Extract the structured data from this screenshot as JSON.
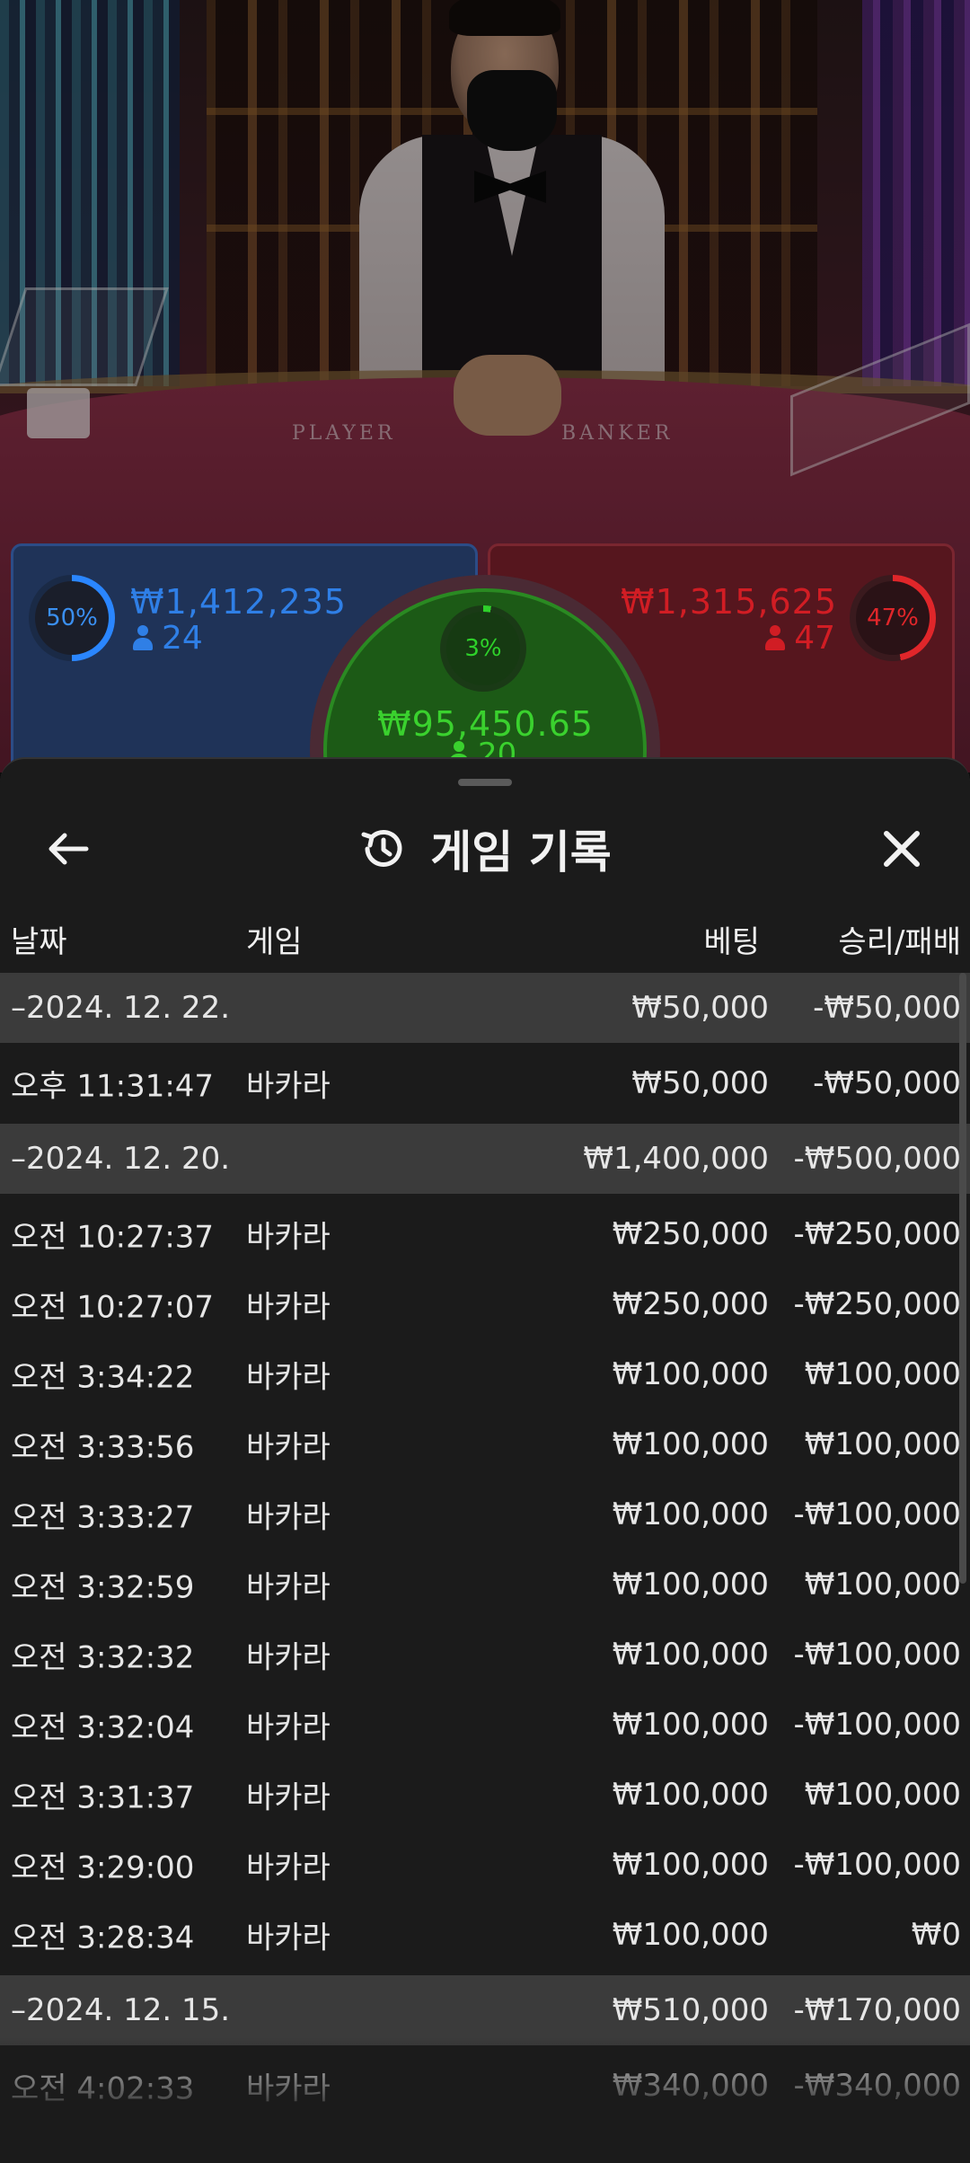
{
  "table": {
    "player_label": "PLAYER",
    "banker_label": "BANKER",
    "player": {
      "percent": "50%",
      "amount": "₩1,412,235",
      "count": "24"
    },
    "banker": {
      "percent": "47%",
      "amount": "₩1,315,625",
      "count": "47"
    },
    "tie": {
      "percent": "3%",
      "amount": "₩95,450.65",
      "count": "20"
    }
  },
  "sheet": {
    "title": "게임 기록",
    "columns": {
      "date": "날짜",
      "game": "게임",
      "bet": "베팅",
      "result": "승리/패배"
    },
    "groups": [
      {
        "date": "–2024. 12. 22.",
        "bet": "₩50,000",
        "result": "-₩50,000",
        "items": [
          {
            "time": "오후 11:31:47",
            "game": "바카라",
            "bet": "₩50,000",
            "result": "-₩50,000"
          }
        ]
      },
      {
        "date": "–2024. 12. 20.",
        "bet": "₩1,400,000",
        "result": "-₩500,000",
        "items": [
          {
            "time": "오전 10:27:37",
            "game": "바카라",
            "bet": "₩250,000",
            "result": "-₩250,000"
          },
          {
            "time": "오전 10:27:07",
            "game": "바카라",
            "bet": "₩250,000",
            "result": "-₩250,000"
          },
          {
            "time": "오전 3:34:22",
            "game": "바카라",
            "bet": "₩100,000",
            "result": "₩100,000"
          },
          {
            "time": "오전 3:33:56",
            "game": "바카라",
            "bet": "₩100,000",
            "result": "₩100,000"
          },
          {
            "time": "오전 3:33:27",
            "game": "바카라",
            "bet": "₩100,000",
            "result": "-₩100,000"
          },
          {
            "time": "오전 3:32:59",
            "game": "바카라",
            "bet": "₩100,000",
            "result": "₩100,000"
          },
          {
            "time": "오전 3:32:32",
            "game": "바카라",
            "bet": "₩100,000",
            "result": "-₩100,000"
          },
          {
            "time": "오전 3:32:04",
            "game": "바카라",
            "bet": "₩100,000",
            "result": "-₩100,000"
          },
          {
            "time": "오전 3:31:37",
            "game": "바카라",
            "bet": "₩100,000",
            "result": "₩100,000"
          },
          {
            "time": "오전 3:29:00",
            "game": "바카라",
            "bet": "₩100,000",
            "result": "-₩100,000"
          },
          {
            "time": "오전 3:28:34",
            "game": "바카라",
            "bet": "₩100,000",
            "result": "₩0"
          }
        ]
      },
      {
        "date": "–2024. 12. 15.",
        "bet": "₩510,000",
        "result": "-₩170,000",
        "items": [
          {
            "time": "오전 4:02:33",
            "game": "바카라",
            "bet": "₩340,000",
            "result": "-₩340,000"
          }
        ]
      }
    ]
  },
  "colors": {
    "player": "#2f7fe6",
    "banker": "#d11d24",
    "tie": "#3ad12e",
    "sheet_bg": "#1b1b1b",
    "date_row_bg": "#3b3b3b"
  }
}
